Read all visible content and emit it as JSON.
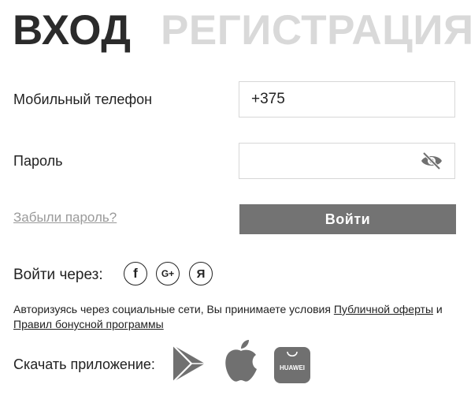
{
  "tabs": {
    "login": "ВХОД",
    "register": "РЕГИСТРАЦИЯ"
  },
  "form": {
    "phone_label": "Мобильный телефон",
    "phone_value": "+375",
    "password_label": "Пароль",
    "password_value": "",
    "forgot_password": "Забыли пароль?",
    "submit_label": "Войти"
  },
  "social": {
    "label": "Войти через:",
    "buttons": [
      {
        "name": "facebook",
        "glyph": "f"
      },
      {
        "name": "google-plus",
        "glyph": "G+"
      },
      {
        "name": "yandex",
        "glyph": "Я"
      }
    ]
  },
  "terms": {
    "text_before": "Авторизуясь через социальные сети, Вы принимаете условия ",
    "link_offer": "Публичной оферты",
    "text_and": " и ",
    "link_bonus": "Правил бонусной программы"
  },
  "apps": {
    "label": "Скачать приложение:",
    "items": [
      {
        "name": "google-play",
        "icon": "google-play-icon"
      },
      {
        "name": "app-store",
        "icon": "apple-icon"
      },
      {
        "name": "huawei-appgallery",
        "icon": "huawei-icon",
        "text": "HUAWEI"
      }
    ]
  },
  "colors": {
    "active_tab": "#2b2b2b",
    "inactive_tab": "#d9d9d9",
    "button_bg": "#737373",
    "icon_gray": "#707070",
    "link_gray": "#9a9a9a"
  }
}
